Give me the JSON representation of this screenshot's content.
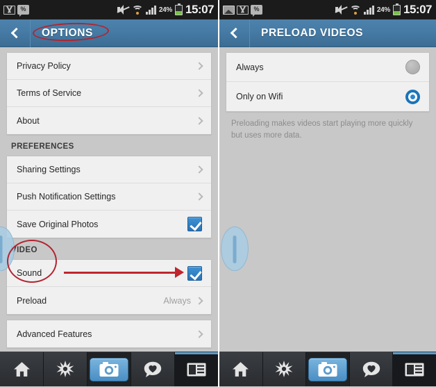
{
  "meta": {
    "accent_blue": "#3c6c93",
    "annotation_red": "#b32430",
    "checkbox_blue": "#2a72b4",
    "radio_selected_blue": "#1a74b8",
    "nav_active_blue": "#4a8ec4"
  },
  "status_bar": {
    "time": "15:07",
    "battery_percent": "24%",
    "percent_badge_glyph": "%",
    "icons_left_panel": [
      "gmail-icon",
      "percent-message-icon"
    ],
    "icons_right_panel": [
      "photo-icon",
      "gmail-icon",
      "percent-message-icon"
    ],
    "icons_right_side": [
      "mute-icon",
      "wifi-icon",
      "signal-icon",
      "battery-icon"
    ]
  },
  "left_panel": {
    "action_bar": {
      "back_label": "",
      "title": "OPTIONS"
    },
    "groups": [
      {
        "header": null,
        "rows": [
          {
            "label": "Privacy Policy",
            "type": "chevron"
          },
          {
            "label": "Terms of Service",
            "type": "chevron"
          },
          {
            "label": "About",
            "type": "chevron"
          }
        ]
      },
      {
        "header": "PREFERENCES",
        "rows": [
          {
            "label": "Sharing Settings",
            "type": "chevron"
          },
          {
            "label": "Push Notification Settings",
            "type": "chevron"
          },
          {
            "label": "Save Original Photos",
            "type": "checkbox",
            "checked": true
          }
        ]
      },
      {
        "header": "VIDEO",
        "rows": [
          {
            "label": "Sound",
            "type": "checkbox",
            "checked": true
          },
          {
            "label": "Preload",
            "type": "chevron",
            "value": "Always"
          }
        ]
      },
      {
        "header": null,
        "rows": [
          {
            "label": "Advanced Features",
            "type": "chevron"
          }
        ]
      }
    ]
  },
  "right_panel": {
    "action_bar": {
      "back_label": "",
      "title": "PRELOAD VIDEOS"
    },
    "options": [
      {
        "label": "Always",
        "selected": false
      },
      {
        "label": "Only on Wifi",
        "selected": true
      }
    ],
    "helper_text": "Preloading makes videos start playing more quickly but uses more data."
  },
  "bottom_nav": {
    "items": [
      {
        "name": "home-icon",
        "active": false
      },
      {
        "name": "explore-compass-icon",
        "active": false
      },
      {
        "name": "camera-icon",
        "active": true
      },
      {
        "name": "activity-heart-icon",
        "active": false
      },
      {
        "name": "news-feed-icon",
        "active": false
      }
    ]
  },
  "annotations": [
    {
      "name": "options-title-ellipse",
      "shape": "ellipse"
    },
    {
      "name": "video-sound-ellipse",
      "shape": "ellipse"
    },
    {
      "name": "sound-checkbox-arrow",
      "shape": "arrow"
    }
  ]
}
